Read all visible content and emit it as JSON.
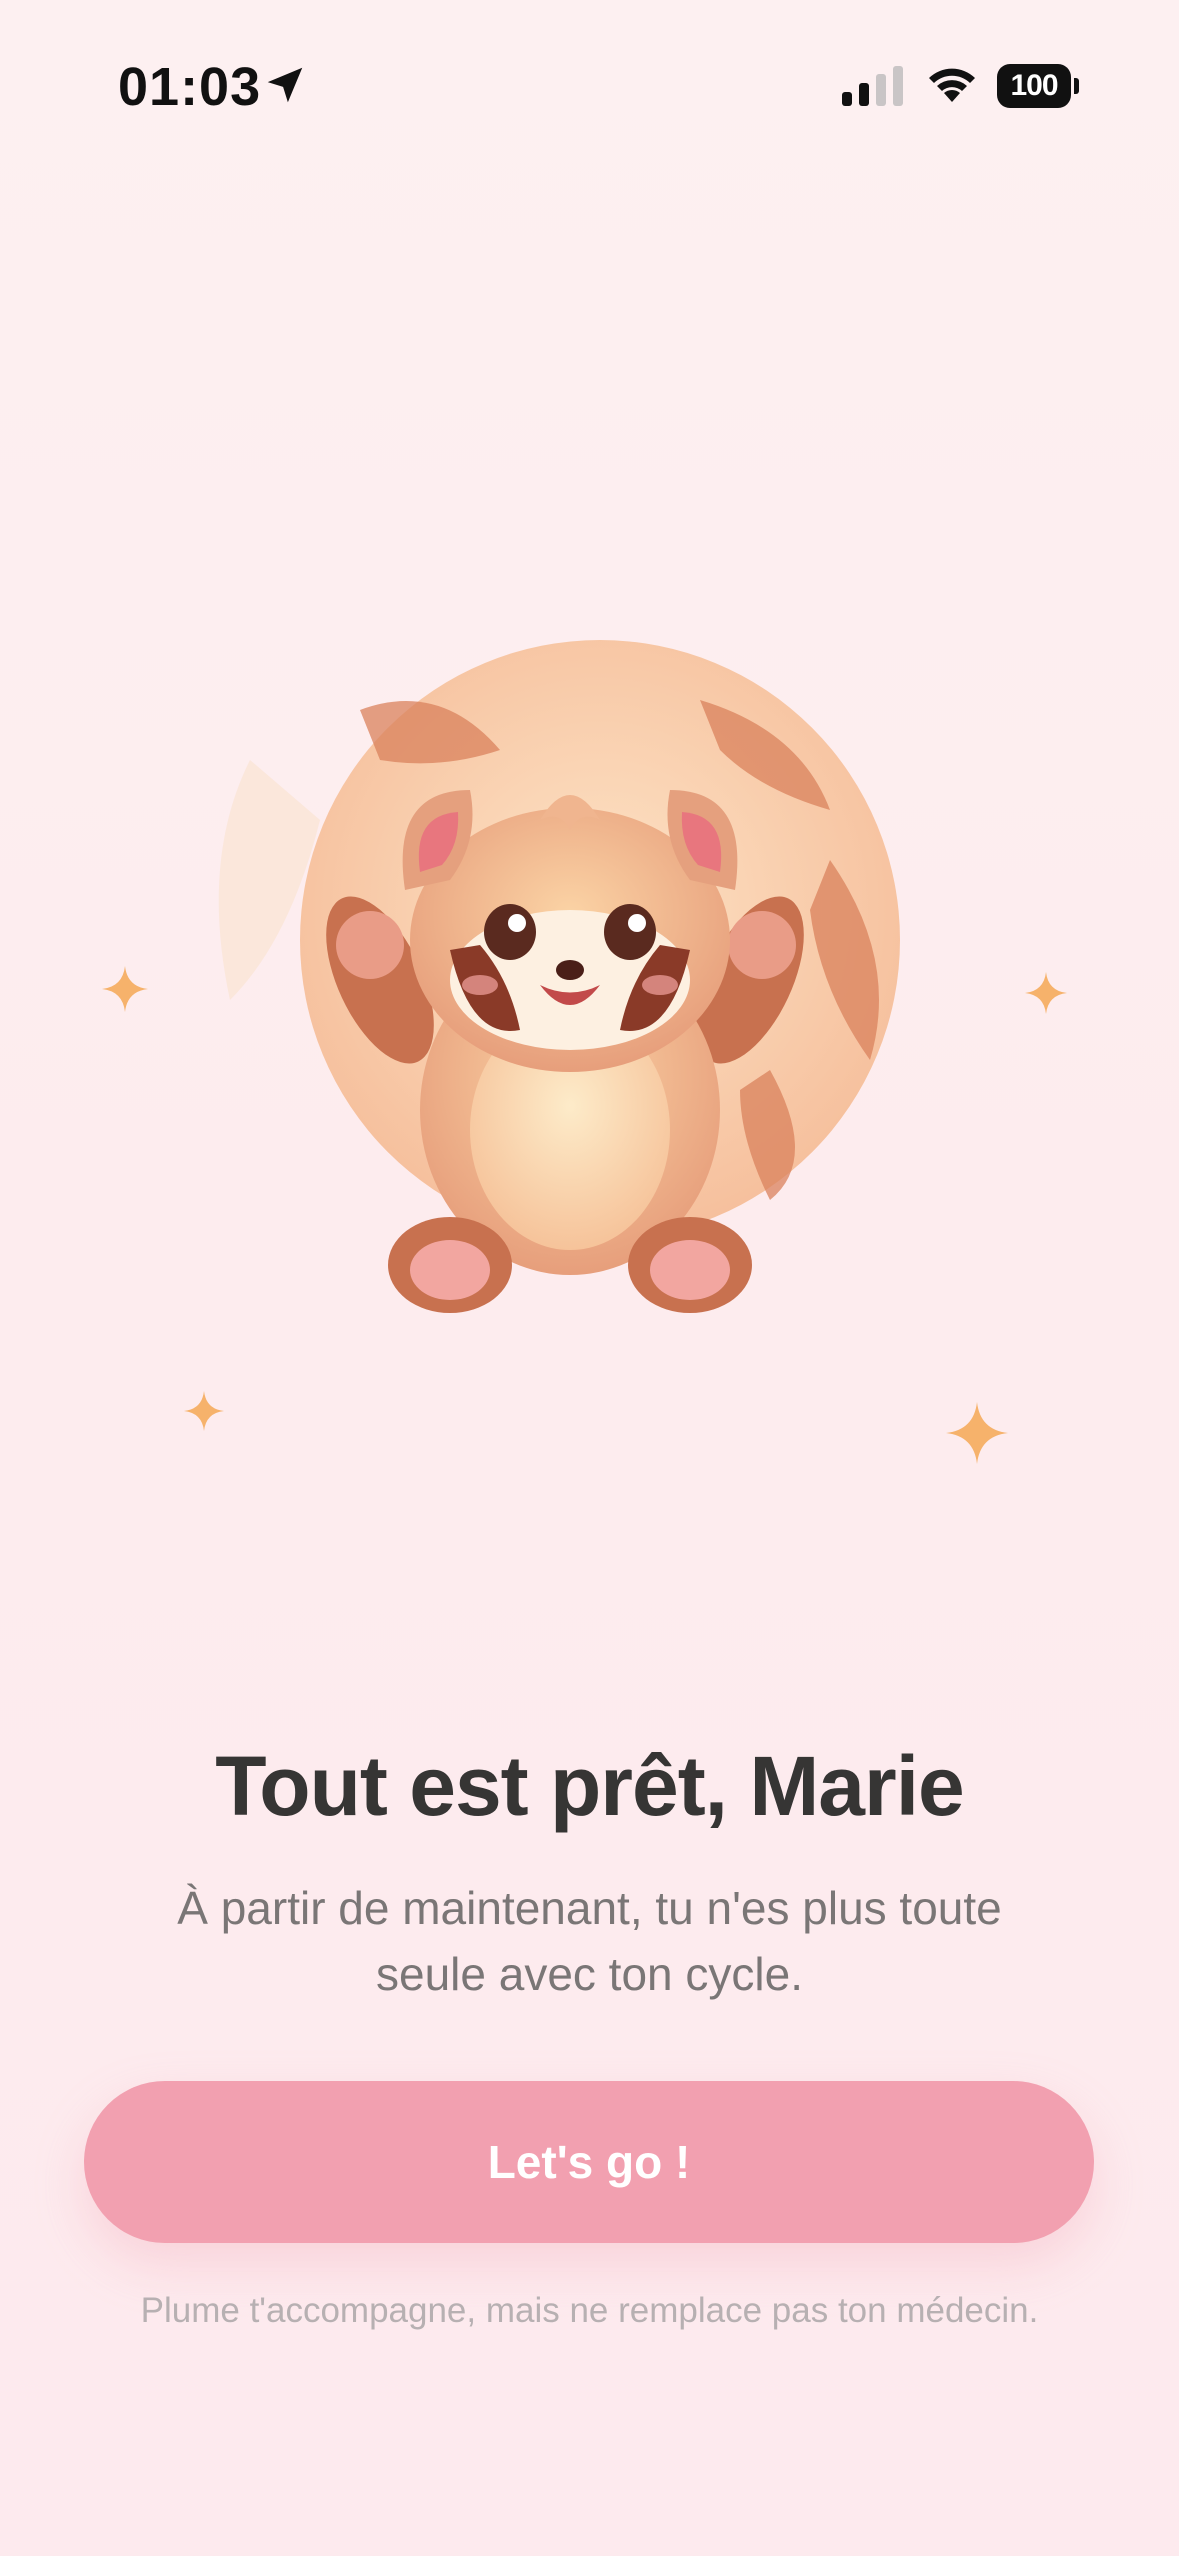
{
  "status_bar": {
    "time": "01:03",
    "battery": "100",
    "icons": [
      "location-arrow-icon",
      "cellular-signal-icon",
      "wifi-icon",
      "battery-icon"
    ]
  },
  "illustration": {
    "subject": "red-panda-mascot",
    "sparkle_color": "#f6b26b"
  },
  "onboarding": {
    "title": "Tout est prêt, Marie",
    "subtitle": "À partir de maintenant, tu n'es plus toute seule avec ton cycle.",
    "cta_label": "Let's go !",
    "disclaimer": "Plume t'accompagne, mais ne remplace pas ton médecin."
  },
  "colors": {
    "background": "#fdeef0",
    "accent": "#f2a0b0",
    "title": "#363534",
    "subtitle": "#7a7676",
    "muted": "#b7b0b2"
  }
}
